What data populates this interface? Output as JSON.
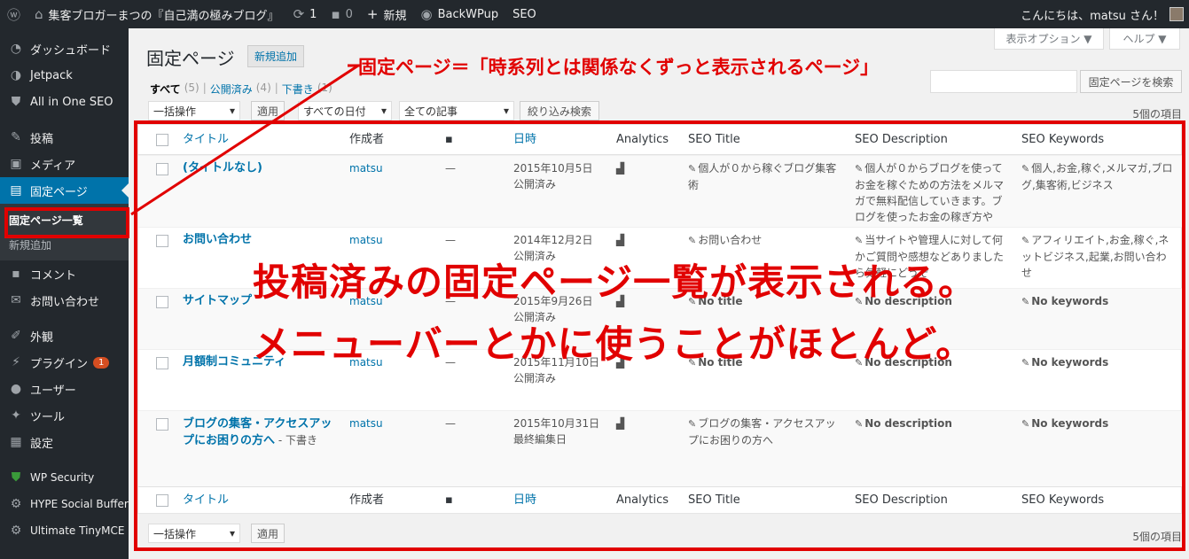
{
  "adminbar": {
    "site_name": "集客ブロガーまつの『自己満の極みブログ』",
    "updates_count": "1",
    "comments_count": "0",
    "new_label": "新規",
    "backwpup": "BackWPup",
    "seo": "SEO",
    "greeting": "こんにちは、matsu さん！"
  },
  "sidebar": {
    "items": [
      {
        "label": "ダッシュボード",
        "icon": "dashboard-icon"
      },
      {
        "label": "Jetpack",
        "icon": "jetpack-icon"
      },
      {
        "label": "All in One SEO",
        "icon": "shield-icon"
      },
      {
        "label": "投稿",
        "icon": "pin-icon"
      },
      {
        "label": "メディア",
        "icon": "media-icon"
      },
      {
        "label": "固定ページ",
        "icon": "page-icon"
      },
      {
        "label": "固定ページ一覧"
      },
      {
        "label": "新規追加"
      },
      {
        "label": "コメント",
        "icon": "comment-icon"
      },
      {
        "label": "お問い合わせ",
        "icon": "mail-icon"
      },
      {
        "label": "外観",
        "icon": "brush-icon"
      },
      {
        "label": "プラグイン",
        "icon": "plugin-icon",
        "badge": "1"
      },
      {
        "label": "ユーザー",
        "icon": "user-icon"
      },
      {
        "label": "ツール",
        "icon": "wrench-icon"
      },
      {
        "label": "設定",
        "icon": "settings-icon"
      },
      {
        "label": "WP Security",
        "icon": "shield-icon"
      },
      {
        "label": "HYPE Social Buffer",
        "icon": "gear-icon"
      },
      {
        "label": "Ultimate TinyMCE",
        "icon": "gear-icon"
      }
    ]
  },
  "header": {
    "screen_options": "表示オプション ▼",
    "help": "ヘルプ ▼",
    "title": "固定ページ",
    "add_new": "新規追加"
  },
  "views": {
    "all": "すべて",
    "all_count": "(5)",
    "published": "公開済み",
    "published_count": "(4)",
    "draft": "下書き",
    "draft_count": "(1)",
    "sep": "|"
  },
  "search": {
    "button": "固定ページを検索"
  },
  "filters": {
    "bulk": "一括操作",
    "apply": "適用",
    "dates": "すべての日付",
    "articles": "全ての記事",
    "filter_button": "絞り込み検索",
    "items_count": "5個の項目"
  },
  "columns": {
    "title": "タイトル",
    "author": "作成者",
    "date": "日時",
    "analytics": "Analytics",
    "seo_title": "SEO Title",
    "seo_desc": "SEO Description",
    "seo_kw": "SEO Keywords"
  },
  "rows": [
    {
      "title": "(タイトルなし)",
      "state": "",
      "author": "matsu",
      "dash": "—",
      "date": "2015年10月5日",
      "status": "公開済み",
      "seo_title": "個人が０から稼ぐブログ集客術",
      "seo_desc": "個人が０からブログを使ってお金を稼ぐための方法をメルマガで無料配信していきます。ブログを使ったお金の稼ぎ方や",
      "seo_kw": "個人,お金,稼ぐ,メルマガ,ブログ,集客術,ビジネス"
    },
    {
      "title": "お問い合わせ",
      "state": "",
      "author": "matsu",
      "dash": "—",
      "date": "2014年12月2日",
      "status": "公開済み",
      "seo_title": "お問い合わせ",
      "seo_desc": "当サイトや管理人に対して何かご質問や感想などありましたら気軽にどうぞ",
      "seo_kw": "アフィリエイト,お金,稼ぐ,ネットビジネス,起業,お問い合わせ"
    },
    {
      "title": "サイトマップ",
      "state": "",
      "author": "matsu",
      "dash": "—",
      "date": "2015年9月26日",
      "status": "公開済み",
      "seo_title": "No title",
      "seo_desc": "No description",
      "seo_kw": "No keywords"
    },
    {
      "title": "月額制コミュニティ",
      "state": "",
      "author": "matsu",
      "dash": "—",
      "date": "2015年11月10日",
      "status": "公開済み",
      "seo_title": "No title",
      "seo_desc": "No description",
      "seo_kw": "No keywords"
    },
    {
      "title": "ブログの集客・アクセスアップにお困りの方へ",
      "state": " - 下書き",
      "author": "matsu",
      "dash": "—",
      "date": "2015年10月31日",
      "status": "最終編集日",
      "seo_title": "ブログの集客・アクセスアップにお困りの方へ",
      "seo_desc": "No description",
      "seo_kw": "No keywords"
    }
  ],
  "annotations": {
    "top": "固定ページ＝「時系列とは関係なくずっと表示されるページ」",
    "big_line1": "投稿済みの固定ページ一覧が表示される。",
    "big_line2": "メニューバーとかに使うことがほとんど。"
  },
  "colors": {
    "annotation": "#e10000",
    "admin_bar": "#23282d",
    "accent": "#0073aa"
  }
}
